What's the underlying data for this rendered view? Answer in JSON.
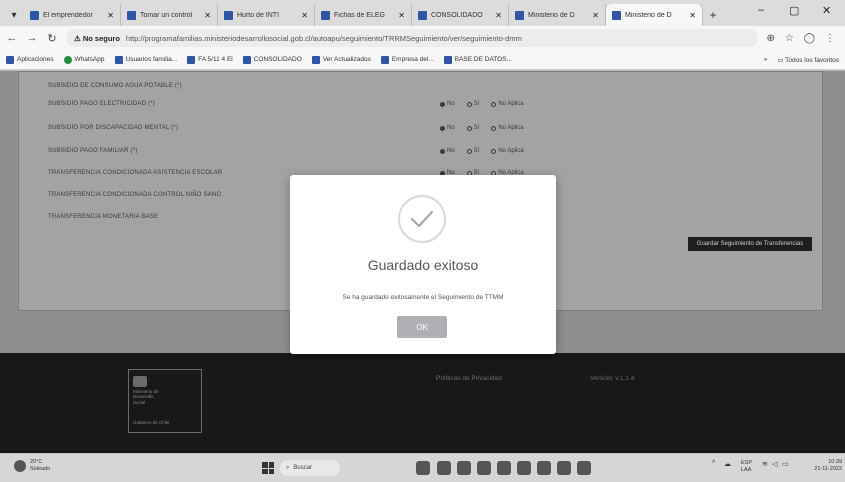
{
  "browser": {
    "tabs": [
      {
        "label": "El emprendedor"
      },
      {
        "label": "Tomar un control"
      },
      {
        "label": "Hurto de INTI"
      },
      {
        "label": "Fichas de ELEG"
      },
      {
        "label": "CONSOLIDADO"
      },
      {
        "label": "Ministerio de D"
      },
      {
        "label": "Ministerio de D"
      }
    ],
    "address": {
      "security": "No seguro",
      "url": "http://programafamilias.ministeriodesarrollosocial.gob.cl/autoapu/seguimiento/TRRMSeguimiento/ver/seguimiento-dmm"
    },
    "bookmarks": [
      {
        "label": "Aplicaciones"
      },
      {
        "label": "WhatsApp"
      },
      {
        "label": "Usuarios familia..."
      },
      {
        "label": "FA 5/11 4 El"
      },
      {
        "label": "CONSOLIDADO"
      },
      {
        "label": "Ver Actualizados"
      },
      {
        "label": "Empresa del..."
      },
      {
        "label": "BASE DE DATOS..."
      }
    ],
    "bookmarks_other": "Todos los favoritos"
  },
  "page": {
    "subsidies": [
      {
        "label": "SUBSIDIO DE CONSUMO AGUA POTABLE (*)",
        "selected": "No"
      },
      {
        "label": "SUBSIDIO PAGO ELECTRICIDAD (*)",
        "selected": "No"
      },
      {
        "label": "SUBSIDIO POR DISCAPACIDAD MENTAL (*)",
        "selected": "No"
      },
      {
        "label": "SUBSIDIO PAGO FAMILIAR (*)",
        "selected": "No"
      },
      {
        "label": "TRANSFERENCIA CONDICIONADA ASISTENCIA ESCOLAR",
        "selected": "No"
      },
      {
        "label": "TRANSFERENCIA CONDICIONADA CONTROL NIÑO SANO",
        "selected": "No"
      },
      {
        "label": "TRANSFERENCIA MONETARIA BASE",
        "selected": ""
      }
    ],
    "radio_options": [
      "No",
      "Sí",
      "No Aplica"
    ],
    "save_button": "Guardar Seguimiento de Transferencias"
  },
  "footer": {
    "logo_text": [
      "Ministerio de",
      "Desarrollo",
      "Social"
    ],
    "logo_subtext": "Gobierno de Chile",
    "link_privacy": "Políticas de Privacidad",
    "link_version": "Versión: v.1.1.4"
  },
  "modal": {
    "title": "Guardado exitoso",
    "message": "Se ha guardado exitosamente el Seguimiento de TTMM",
    "ok_label": "OK"
  },
  "taskbar": {
    "weather_temp": "20°C",
    "weather_desc": "Soleado",
    "search_placeholder": "Buscar",
    "lang": "ESP",
    "lang_sub": "LAA",
    "time": "10:39",
    "date": "21-11-2023"
  }
}
